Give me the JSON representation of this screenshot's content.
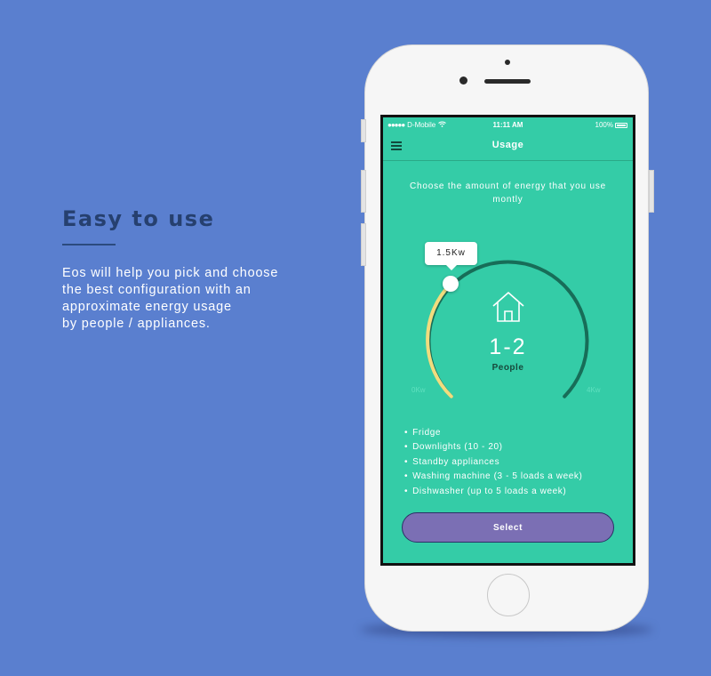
{
  "promo": {
    "title": "Easy to use",
    "description_lines": [
      "Eos will help you pick and choose",
      "the best configuration with an",
      "approximate energy usage",
      "by people / appliances."
    ]
  },
  "status_bar": {
    "signal": "●●●●●",
    "carrier": "D-Mobile",
    "time": "11:11 AM",
    "battery": "100%"
  },
  "nav": {
    "title": "Usage",
    "menu_icon": "hamburger-menu-icon"
  },
  "prompt": "Choose the amount of energy that you use montly",
  "gauge": {
    "tooltip": "1.5Kw",
    "value": "1-2",
    "label": "People",
    "min_label": "0Kw",
    "max_label": "4Kw",
    "min_kw": 0,
    "max_kw": 4,
    "selected_kw": 1.5,
    "icon": "house-icon",
    "colors": {
      "filled": "#f1dc7e",
      "track": "#176d58",
      "background": "#34cca7"
    }
  },
  "appliances": [
    "Fridge",
    "Downlights (10 - 20)",
    "Standby appliances",
    "Washing machine (3 - 5 loads a week)",
    "Dishwasher (up to 5 loads a week)"
  ],
  "select_button": "Select",
  "colors": {
    "page_background": "#5a7fcf",
    "promo_title": "#26406f",
    "screen": "#34cca7",
    "button": "#7b6fb4"
  }
}
